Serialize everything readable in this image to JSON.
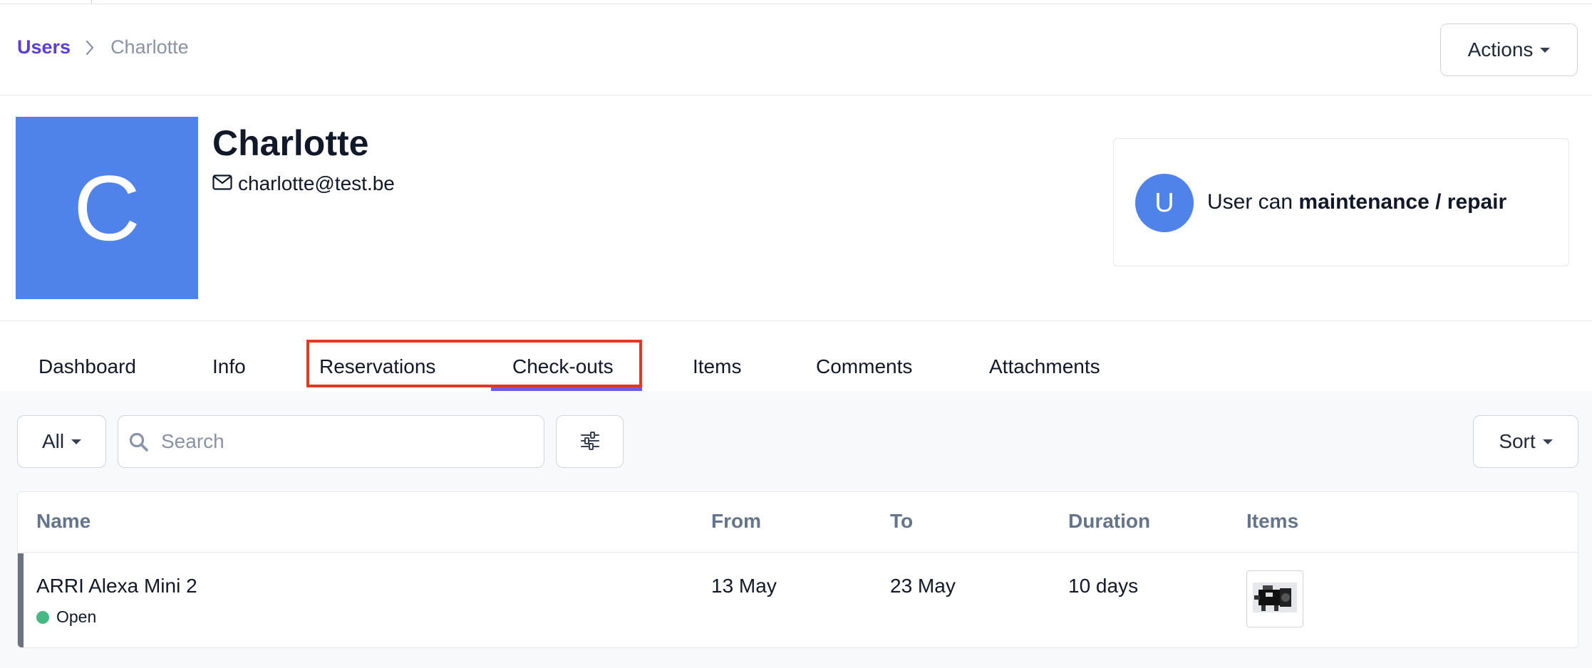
{
  "breadcrumb": {
    "parent": "Users",
    "current": "Charlotte"
  },
  "header": {
    "actions_label": "Actions"
  },
  "user": {
    "initial": "C",
    "name": "Charlotte",
    "email": "charlotte@test.be"
  },
  "permission": {
    "initial": "U",
    "prefix": "User can ",
    "capability": "maintenance / repair"
  },
  "tabs": [
    {
      "label": "Dashboard"
    },
    {
      "label": "Info"
    },
    {
      "label": "Reservations"
    },
    {
      "label": "Check-outs",
      "active": true
    },
    {
      "label": "Items"
    },
    {
      "label": "Comments"
    },
    {
      "label": "Attachments"
    }
  ],
  "toolbar": {
    "filter_label": "All",
    "search_placeholder": "Search",
    "sort_label": "Sort"
  },
  "table": {
    "columns": [
      "Name",
      "From",
      "To",
      "Duration",
      "Items"
    ],
    "rows": [
      {
        "name": "ARRI Alexa Mini 2",
        "status": "Open",
        "from": "13 May",
        "to": "23 May",
        "duration": "10 days"
      }
    ]
  },
  "colors": {
    "brand": "#5b3ed6",
    "avatar": "#4f83ea",
    "active_tab": "#6d5ce8",
    "status_open": "#47b881",
    "highlight": "#e03a24"
  },
  "icons": {
    "breadcrumb_separator": "chevron-right-icon",
    "email": "envelope-icon",
    "search": "search-icon",
    "filter_settings": "sliders-icon",
    "dropdown": "caret-down-icon"
  }
}
